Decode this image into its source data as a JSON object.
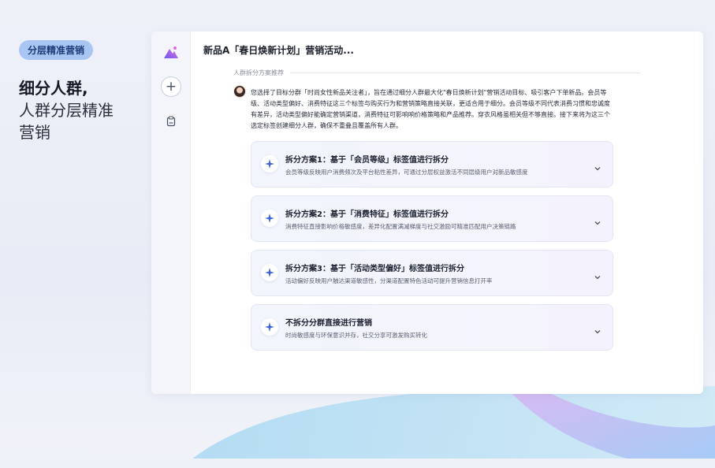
{
  "left": {
    "badge": "分层精准营销",
    "headline": "细分人群,",
    "subline1": "人群分层精准",
    "subline2": "营销"
  },
  "rail": {
    "icons": [
      "app-logo-icon",
      "plus-icon",
      "clipboard-icon"
    ]
  },
  "chat": {
    "title": "新品A「春日焕新计划」营销活动...",
    "section_label": "人群拆分方案推荐",
    "intro": "您选择了目标分群「时尚女性新品关注者」，旨在通过细分人群最大化\"春日焕新计划\"营销活动目标、吸引客户下单新品。会员等级、活动类型偏好、消费特征这三个标签与购买行为和营销策略直接关联，更适合用于细分。会员等级不同代表消费习惯和忠诚度有差异，活动类型偏好能确定营销渠道，消费特征可影响响价格策略和产品推荐。穿衣风格虽相关但不够直接。接下来将为这三个选定标签创建细分人群，确保不重叠且覆盖所有人群。",
    "options": [
      {
        "title": "拆分方案1：基于「会员等级」标签值进行拆分",
        "desc": "会员等级反映用户消费频次及平台粘性差异，可通过分层权益激活不同层级用户对新品敏感度"
      },
      {
        "title": "拆分方案2：基于「消费特征」标签值进行拆分",
        "desc": "消费特征直接影响价格敏感度，差异化配置满减梯度与社交激励可精准匹配用户决策链路"
      },
      {
        "title": "拆分方案3：基于「活动类型偏好」标签值进行拆分",
        "desc": "活动偏好反映用户触达渠道敏感性，分渠道配置特色活动可提升营销信息打开率"
      },
      {
        "title": "不拆分分群直接进行营销",
        "desc": "时尚敏感度与环保意识并存，社交分享可激发购买转化"
      }
    ]
  },
  "colors": {
    "accent": "#3b63d8",
    "badge_bg": "#a9c6f3",
    "card_bg": "#f2f5fc"
  }
}
